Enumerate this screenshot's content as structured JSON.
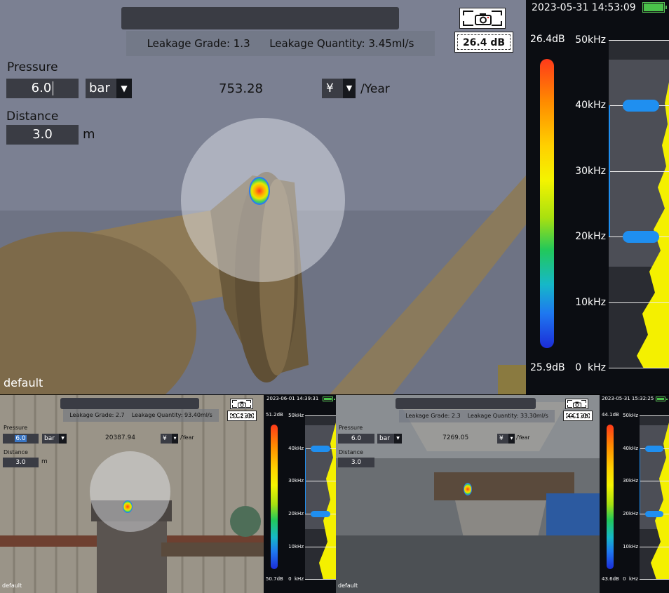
{
  "main": {
    "leak_grade": "Leakage Grade: 1.3",
    "leak_quantity": "Leakage Quantity: 3.45ml/s",
    "db_value": "26.4 dB",
    "pressure_label": "Pressure",
    "pressure_value": "6.0",
    "pressure_unit": "bar",
    "cost_value": "753.28",
    "currency": "¥",
    "per_year": "/Year",
    "distance_label": "Distance",
    "distance_value": "3.0",
    "distance_unit": "m",
    "preset": "default",
    "spectrum": {
      "timestamp": "2023-05-31 14:53:09",
      "db_max": "26.4dB",
      "db_min": "25.9dB",
      "f_top": "50kHz",
      "f_40": "40kHz",
      "f_30": "30kHz",
      "f_20": "20kHz",
      "f_10": "10kHz",
      "f_0": "0  kHz",
      "marker_high_khz": 40,
      "marker_low_khz": 20,
      "battery_level": 1.0
    }
  },
  "bottom_left": {
    "leak_grade": "Leakage Grade: 2.7",
    "leak_quantity": "Leakage Quantity: 93.40ml/s",
    "db_value": "51.2 dB",
    "pressure_label": "Pressure",
    "pressure_value": "6.0",
    "pressure_unit": "bar",
    "cost_value": "20387.94",
    "currency": "¥",
    "per_year": "/Year",
    "distance_label": "Distance",
    "distance_value": "3.0",
    "distance_unit": "m",
    "preset": "default",
    "spectrum": {
      "timestamp": "2023-06-01 14:39:31",
      "db_max": "51.2dB",
      "db_min": "50.7dB",
      "f_top": "50kHz",
      "f_40": "40kHz",
      "f_30": "30kHz",
      "f_20": "20kHz",
      "f_10": "10kHz",
      "f_0": "0  kHz",
      "marker_high_khz": 40,
      "marker_low_khz": 20,
      "battery_level": 1.0
    }
  },
  "bottom_right": {
    "leak_grade": "Leakage Grade: 2.3",
    "leak_quantity": "Leakage Quantity: 33.30ml/s",
    "db_value": "44.1 dB",
    "pressure_label": "Pressure",
    "pressure_value": "6.0",
    "pressure_unit": "bar",
    "cost_value": "7269.05",
    "currency": "¥",
    "per_year": "/Year",
    "distance_label": "Distance",
    "distance_value": "3.0",
    "distance_unit": "m",
    "preset": "default",
    "spectrum": {
      "timestamp": "2023-05-31 15:32:25",
      "db_max": "44.1dB",
      "db_min": "43.6dB",
      "f_top": "50kHz",
      "f_40": "40kHz",
      "f_30": "30kHz",
      "f_20": "20kHz",
      "f_10": "10kHz",
      "f_0": "0  kHz",
      "marker_high_khz": 40,
      "marker_low_khz": 20,
      "battery_level": 1.0
    }
  },
  "colors": {
    "marker": "#1f8ff0",
    "spectrum_fill": "#f4f000",
    "ui_field": "#3a3c44"
  }
}
